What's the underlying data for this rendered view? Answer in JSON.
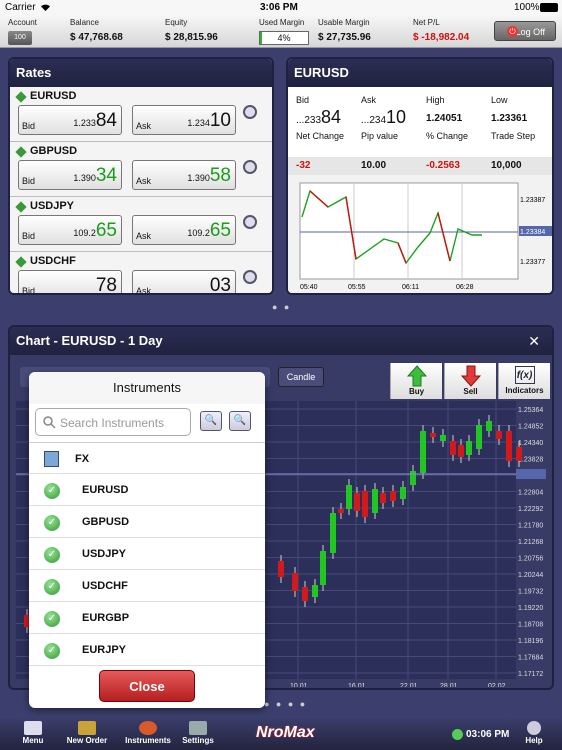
{
  "status": {
    "carrier": "Carrier",
    "time": "3:06 PM",
    "battery": "100%"
  },
  "account": {
    "account_label": "Account",
    "account_button": "100",
    "balance_label": "Balance",
    "balance": "$ 47,768.68",
    "equity_label": "Equity",
    "equity": "$ 28,815.96",
    "used_margin_label": "Used Margin",
    "used_margin": "4%",
    "used_margin_pct": 4,
    "usable_margin_label": "Usable Margin",
    "usable_margin": "$ 27,735.96",
    "netpl_label": "Net P/L",
    "netpl": "$ -18,982.04",
    "logoff": "Log Off"
  },
  "rates": {
    "title": "Rates",
    "bid_label": "Bid",
    "ask_label": "Ask",
    "items": [
      {
        "name": "EURUSD",
        "bid_pre": "1.233",
        "bid_big": "84",
        "ask_pre": "1.234",
        "ask_big": "10"
      },
      {
        "name": "GBPUSD",
        "bid_pre": "1.390",
        "bid_big": "34",
        "ask_pre": "1.390",
        "ask_big": "58"
      },
      {
        "name": "USDJPY",
        "bid_pre": "109.2",
        "bid_big": "65",
        "ask_pre": "109.2",
        "ask_big": "65"
      },
      {
        "name": "USDCHF",
        "bid_pre": "",
        "bid_big": "78",
        "ask_pre": "",
        "ask_big": "03"
      }
    ]
  },
  "detail": {
    "title": "EURUSD",
    "bid_label": "Bid",
    "bid_pre": "...233",
    "bid_big": "84",
    "ask_label": "Ask",
    "ask_pre": "...234",
    "ask_big": "10",
    "high_label": "High",
    "high": "1.24051",
    "low_label": "Low",
    "low": "1.23361",
    "netchange_label": "Net Change",
    "netchange": "-32",
    "pip_label": "Pip value",
    "pip": "10.00",
    "pct_label": "% Change",
    "pct": "-0.2563",
    "tradestep_label": "Trade Step",
    "tradestep": "10,000",
    "mini_y": [
      "1.23387",
      "1.23384",
      "1.23377"
    ],
    "mini_x": [
      "05:40",
      "05:55",
      "06:11",
      "06:28"
    ]
  },
  "chart": {
    "title": "Chart - EURUSD - 1 Day",
    "candle_label": "Candle",
    "buy": "Buy",
    "sell": "Sell",
    "indicators": "Indicators",
    "y_labels": [
      "1.25364",
      "1.24852",
      "1.24340",
      "1.23828",
      "1.23384",
      "1.22804",
      "1.22292",
      "1.21780",
      "1.21268",
      "1.20756",
      "1.20244",
      "1.19732",
      "1.19220",
      "1.18708",
      "1.18196",
      "1.17684",
      "1.17172"
    ],
    "x_labels": [
      "10.01",
      "16.01",
      "22.01",
      "28.01",
      "02.02"
    ]
  },
  "instruments": {
    "title": "Instruments",
    "search_placeholder": "Search Instruments",
    "group": "FX",
    "items": [
      "EURUSD",
      "GBPUSD",
      "USDJPY",
      "USDCHF",
      "EURGBP",
      "EURJPY"
    ],
    "close": "Close"
  },
  "bottom": {
    "menu": "Menu",
    "new_order": "New Order",
    "instruments": "Instruments",
    "settings": "Settings",
    "brand": "NroMax",
    "time": "03:06 PM",
    "help": "Help"
  }
}
